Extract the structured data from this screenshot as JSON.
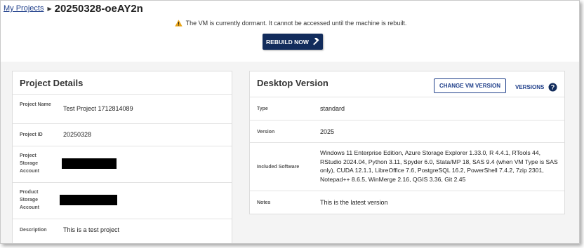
{
  "breadcrumb": {
    "link_label": "My Projects",
    "separator_icon": "triangle-right-icon",
    "title": "20250328-oeAY2n"
  },
  "banner": {
    "icon": "warning-icon",
    "icon_color": "#e8a317",
    "message": "The VM is currently dormant. It cannot be accessed until the machine is rebuilt."
  },
  "rebuild_button": {
    "label": "REBUILD NOW",
    "icon": "hammer-icon",
    "color": "#122c5c"
  },
  "project_details": {
    "title": "Project Details",
    "rows": [
      {
        "label": "Project Name",
        "value": "Test Project 1712814089"
      },
      {
        "label": "Project ID",
        "value": "20250328"
      },
      {
        "label": "Project Storage Account",
        "value": ""
      },
      {
        "label": "Product Storage Account",
        "value": ""
      },
      {
        "label": "Description",
        "value": "This is a test project"
      }
    ]
  },
  "desktop_version": {
    "title": "Desktop Version",
    "change_button": "CHANGE VM VERSION",
    "versions_link": "VERSIONS",
    "help_icon": "question-circle-icon",
    "rows": [
      {
        "label": "Type",
        "value": "standard"
      },
      {
        "label": "Version",
        "value": "2025"
      },
      {
        "label": "Included Software",
        "value": "Windows 11 Enterprise Edition, Azure Storage Explorer 1.33.0, R 4.4.1, RTools 44, RStudio 2024.04, Python 3.11, Spyder 6.0, Stata/MP 18, SAS 9.4 (when VM Type is SAS only), CUDA 12.1.1, LibreOffice 7.6, PostgreSQL 16.2, PowerShell 7.4.2, 7zip 2301, Notepad++ 8.6.5, WinMerge 2.16, QGIS 3.36, Git 2.45"
      },
      {
        "label": "Notes",
        "value": "This is the latest version"
      }
    ]
  },
  "colors": {
    "accent": "#1f3f8a",
    "primary_button": "#122c5c",
    "warning": "#e8a317"
  }
}
